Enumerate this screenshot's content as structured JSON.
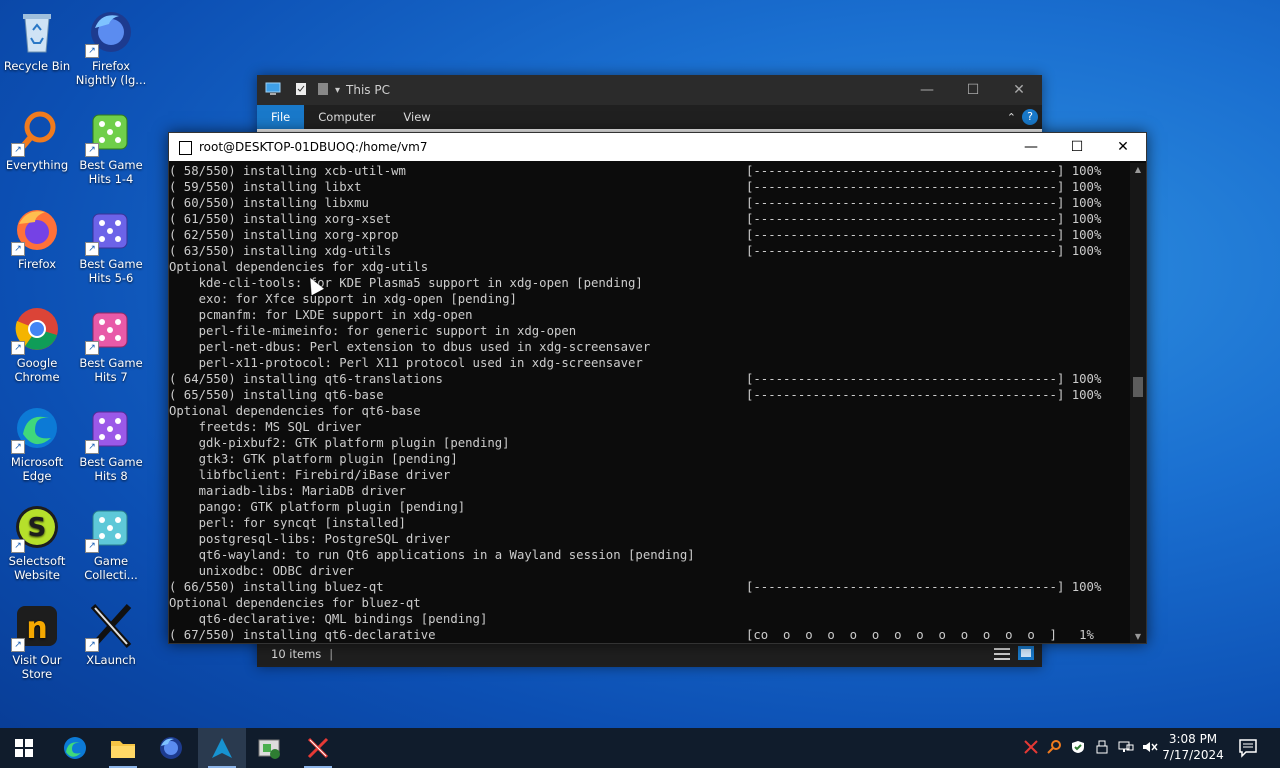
{
  "desktop": {
    "icons": [
      {
        "label": "Recycle Bin"
      },
      {
        "label": "Firefox Nightly (lg..."
      },
      {
        "label": "Everything"
      },
      {
        "label": "Best Game Hits 1-4"
      },
      {
        "label": "Firefox"
      },
      {
        "label": "Best Game Hits 5-6"
      },
      {
        "label": "Google Chrome"
      },
      {
        "label": "Best Game Hits 7"
      },
      {
        "label": "Microsoft Edge"
      },
      {
        "label": "Best Game Hits 8"
      },
      {
        "label": "Selectsoft Website"
      },
      {
        "label": "Game Collecti..."
      },
      {
        "label": "Visit Our Store"
      },
      {
        "label": "XLaunch"
      }
    ]
  },
  "explorer": {
    "title": "This PC",
    "tabs": [
      "File",
      "Computer",
      "View"
    ],
    "status": "10 items"
  },
  "terminal": {
    "title": "root@DESKTOP-01DBUOQ:/home/vm7",
    "lines": [
      "( 58/550) installing xcb-util-wm",
      "( 59/550) installing libxt",
      "( 60/550) installing libxmu",
      "( 61/550) installing xorg-xset",
      "( 62/550) installing xorg-xprop",
      "( 63/550) installing xdg-utils",
      "Optional dependencies for xdg-utils",
      "    kde-cli-tools: for KDE Plasma5 support in xdg-open [pending]",
      "    exo: for Xfce support in xdg-open [pending]",
      "    pcmanfm: for LXDE support in xdg-open",
      "    perl-file-mimeinfo: for generic support in xdg-open",
      "    perl-net-dbus: Perl extension to dbus used in xdg-screensaver",
      "    perl-x11-protocol: Perl X11 protocol used in xdg-screensaver",
      "( 64/550) installing qt6-translations",
      "( 65/550) installing qt6-base",
      "Optional dependencies for qt6-base",
      "    freetds: MS SQL driver",
      "    gdk-pixbuf2: GTK platform plugin [pending]",
      "    gtk3: GTK platform plugin [pending]",
      "    libfbclient: Firebird/iBase driver",
      "    mariadb-libs: MariaDB driver",
      "    pango: GTK platform plugin [pending]",
      "    perl: for syncqt [installed]",
      "    postgresql-libs: PostgreSQL driver",
      "    qt6-wayland: to run Qt6 applications in a Wayland session [pending]",
      "    unixodbc: ODBC driver",
      "( 66/550) installing bluez-qt",
      "Optional dependencies for bluez-qt",
      "    qt6-declarative: QML bindings [pending]",
      "( 67/550) installing qt6-declarative"
    ],
    "progress": [
      {
        "row": 0,
        "text": "[-----------------------------------------] 100%",
        "value": 100
      },
      {
        "row": 1,
        "text": "[-----------------------------------------] 100%",
        "value": 100
      },
      {
        "row": 2,
        "text": "[-----------------------------------------] 100%",
        "value": 100
      },
      {
        "row": 3,
        "text": "[-----------------------------------------] 100%",
        "value": 100
      },
      {
        "row": 4,
        "text": "[-----------------------------------------] 100%",
        "value": 100
      },
      {
        "row": 5,
        "text": "[-----------------------------------------] 100%",
        "value": 100
      },
      {
        "row": 13,
        "text": "[-----------------------------------------] 100%",
        "value": 100
      },
      {
        "row": 14,
        "text": "[-----------------------------------------] 100%",
        "value": 100
      },
      {
        "row": 26,
        "text": "[-----------------------------------------] 100%",
        "value": 100
      },
      {
        "row": 29,
        "text": "[co  o  o  o  o  o  o  o  o  o  o  o  o  ]   1%",
        "value": 1
      }
    ]
  },
  "taskbar": {
    "time": "3:08 PM",
    "date": "7/17/2024"
  }
}
